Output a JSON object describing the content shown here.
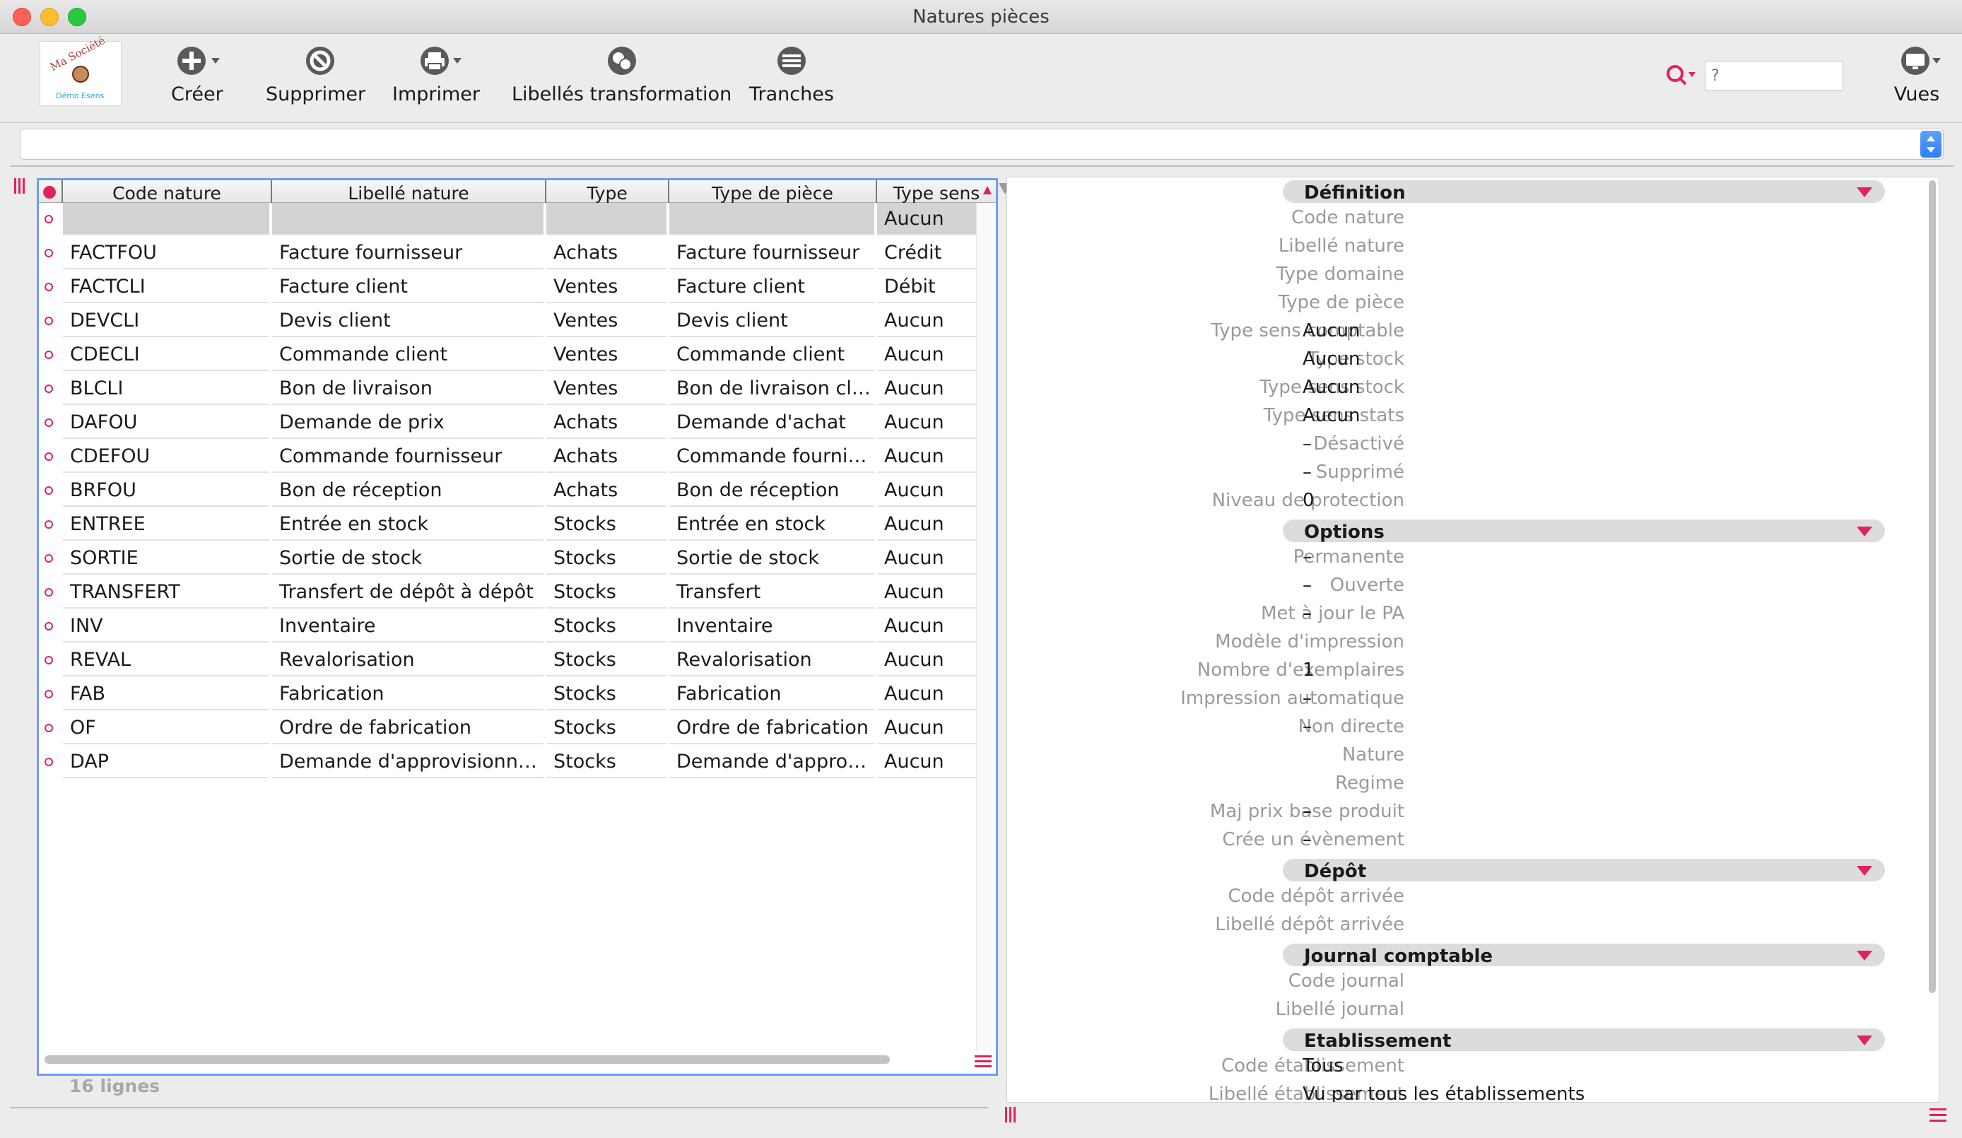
{
  "window": {
    "title": "Natures pièces"
  },
  "logo": {
    "line1": "Ma Société",
    "line2": "Démo Esens"
  },
  "toolbar": {
    "create_label": "Créer",
    "delete_label": "Supprimer",
    "print_label": "Imprimer",
    "labels_label": "Libellés transformation",
    "ranges_label": "Tranches",
    "views_label": "Vues"
  },
  "search": {
    "placeholder": "?"
  },
  "colors": {
    "accent": "#e0235a",
    "selection": "#6f9cf0",
    "header_grey": "#dcdcdc"
  },
  "table": {
    "columns": [
      "Code nature",
      "Libellé nature",
      "Type",
      "Type de pièce",
      "Type sens"
    ],
    "rows": [
      [
        "",
        "",
        "",
        "",
        "Aucun"
      ],
      [
        "FACTFOU",
        "Facture fournisseur",
        "Achats",
        "Facture fournisseur",
        "Crédit"
      ],
      [
        "FACTCLI",
        "Facture client",
        "Ventes",
        "Facture client",
        "Débit"
      ],
      [
        "DEVCLI",
        "Devis client",
        "Ventes",
        "Devis client",
        "Aucun"
      ],
      [
        "CDECLI",
        "Commande client",
        "Ventes",
        "Commande client",
        "Aucun"
      ],
      [
        "BLCLI",
        "Bon de livraison",
        "Ventes",
        "Bon de livraison client",
        "Aucun"
      ],
      [
        "DAFOU",
        "Demande de prix",
        "Achats",
        "Demande d'achat",
        "Aucun"
      ],
      [
        "CDEFOU",
        "Commande fournisseur",
        "Achats",
        "Commande fourniss...",
        "Aucun"
      ],
      [
        "BRFOU",
        "Bon de réception",
        "Achats",
        "Bon de réception",
        "Aucun"
      ],
      [
        "ENTREE",
        "Entrée en stock",
        "Stocks",
        "Entrée en stock",
        "Aucun"
      ],
      [
        "SORTIE",
        "Sortie de stock",
        "Stocks",
        "Sortie de stock",
        "Aucun"
      ],
      [
        "TRANSFERT",
        "Transfert de dépôt à dépôt",
        "Stocks",
        "Transfert",
        "Aucun"
      ],
      [
        "INV",
        "Inventaire",
        "Stocks",
        "Inventaire",
        "Aucun"
      ],
      [
        "REVAL",
        "Revalorisation",
        "Stocks",
        "Revalorisation",
        "Aucun"
      ],
      [
        "FAB",
        "Fabrication",
        "Stocks",
        "Fabrication",
        "Aucun"
      ],
      [
        "OF",
        "Ordre de fabrication",
        "Stocks",
        "Ordre de fabrication",
        "Aucun"
      ],
      [
        "DAP",
        "Demande d'approvisionne...",
        "Stocks",
        "Demande d'approvi...",
        "Aucun"
      ]
    ],
    "footer": "16 lignes"
  },
  "detail": {
    "sections": [
      {
        "title": "Définition",
        "fields": [
          {
            "label": "Code nature",
            "value": ""
          },
          {
            "label": "Libellé nature",
            "value": ""
          },
          {
            "label": "Type domaine",
            "value": ""
          },
          {
            "label": "Type de pièce",
            "value": ""
          },
          {
            "label": "Type sens comptable",
            "value": "Aucun"
          },
          {
            "label": "Type stock",
            "value": "Aucun"
          },
          {
            "label": "Type sens stock",
            "value": "Aucun"
          },
          {
            "label": "Type sens stats",
            "value": "Aucun"
          },
          {
            "label": "Désactivé",
            "value": "–"
          },
          {
            "label": "Supprimé",
            "value": "–"
          },
          {
            "label": "Niveau de protection",
            "value": "0"
          }
        ]
      },
      {
        "title": "Options",
        "fields": [
          {
            "label": "Permanente",
            "value": "–"
          },
          {
            "label": "Ouverte",
            "value": "–"
          },
          {
            "label": "Met à jour le PA",
            "value": "–"
          },
          {
            "label": "Modèle d'impression",
            "value": ""
          },
          {
            "label": "Nombre d'exemplaires",
            "value": "1"
          },
          {
            "label": "Impression automatique",
            "value": "–"
          },
          {
            "label": "Non directe",
            "value": "–"
          },
          {
            "label": "Nature",
            "value": ""
          },
          {
            "label": "Regime",
            "value": ""
          },
          {
            "label": "Maj prix base produit",
            "value": "–"
          },
          {
            "label": "Crée un évènement",
            "value": "–"
          }
        ]
      },
      {
        "title": "Dépôt",
        "fields": [
          {
            "label": "Code dépôt arrivée",
            "value": ""
          },
          {
            "label": "Libellé dépôt arrivée",
            "value": ""
          }
        ]
      },
      {
        "title": "Journal comptable",
        "fields": [
          {
            "label": "Code journal",
            "value": ""
          },
          {
            "label": "Libellé journal",
            "value": ""
          }
        ]
      },
      {
        "title": "Etablissement",
        "fields": [
          {
            "label": "Code établissement",
            "value": "Tous"
          },
          {
            "label": "Libellé établissement",
            "value": "Vu par tous les établissements"
          }
        ]
      }
    ]
  }
}
